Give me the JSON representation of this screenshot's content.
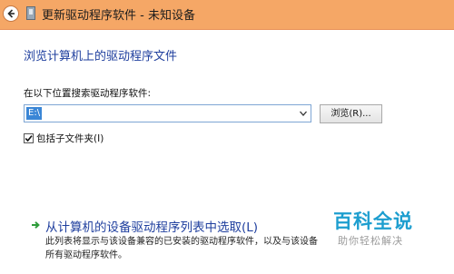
{
  "window": {
    "title": "更新驱动程序软件 - 未知设备"
  },
  "main": {
    "heading": "浏览计算机上的驱动程序文件",
    "search_label": "在以下位置搜索驱动程序软件:",
    "path_value": "E:\\",
    "browse_label": "浏览(R)...",
    "include_subfolders_label": "包括子文件夹(I)",
    "include_subfolders_checked": true,
    "pick_link_title": "从计算机的设备驱动程序列表中选取(L)",
    "pick_link_desc": "此列表将显示与该设备兼容的已安装的驱动程序软件，以及与该设备 所有驱动程序软件。"
  },
  "watermark": {
    "main": "百科全说",
    "sub": "助你轻松解决"
  },
  "colors": {
    "titlebar": "#f5a766",
    "heading": "#1f3f9e",
    "selection": "#3a86d6",
    "link_arrow": "#2e9c3a",
    "watermark": "#1d9ecf"
  },
  "icons": {
    "back": "back-arrow-icon",
    "window": "device-icon",
    "dropdown": "chevron-down-icon",
    "checkbox": "checkmark-icon",
    "link": "green-arrow-icon"
  }
}
